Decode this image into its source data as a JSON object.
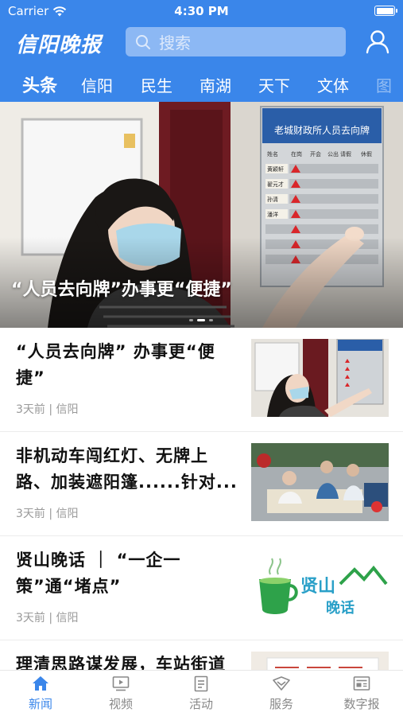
{
  "status_bar": {
    "carrier": "Carrier",
    "time": "4:30 PM"
  },
  "header": {
    "logo_text": "信阳晚报",
    "search_placeholder": "搜索",
    "brand_color": "#3a86ea"
  },
  "channel_tabs": [
    {
      "label": "头条",
      "active": true
    },
    {
      "label": "信阳"
    },
    {
      "label": "民生"
    },
    {
      "label": "南湖"
    },
    {
      "label": "天下"
    },
    {
      "label": "文体"
    },
    {
      "label": "图"
    }
  ],
  "banner": {
    "title": "“人员去向牌”办事更“便捷”",
    "board_heading": "老城财政所人员去向牌",
    "board_columns": [
      "姓名",
      "在岗",
      "开会",
      "公出",
      "请假",
      "休假"
    ],
    "board_names": [
      "黄颖轩",
      "翟元才",
      "孙清",
      "潘洋"
    ],
    "slide_count": 3,
    "active_slide": 2
  },
  "news": [
    {
      "title": "“人员去向牌” 办事更“便捷”",
      "meta": "3天前 | 信阳",
      "thumb": "board-photo"
    },
    {
      "title": "非机动车闯红灯、无牌上路、加装遮阳篷......针对...",
      "meta": "3天前 | 信阳",
      "thumb": "police-photo"
    },
    {
      "title": "贤山晚话 ｜ “一企一策”通“堵点”",
      "meta": "3天前 | 信阳",
      "thumb": "xianshan-logo",
      "thumb_text": [
        "贤山",
        "晚话"
      ]
    },
    {
      "title": "理清思路谋发展，车站街道",
      "meta": "",
      "thumb": "document-photo"
    }
  ],
  "tabbar": [
    {
      "label": "新闻",
      "icon": "home-icon",
      "active": true
    },
    {
      "label": "视频",
      "icon": "video-icon"
    },
    {
      "label": "活动",
      "icon": "activity-icon"
    },
    {
      "label": "服务",
      "icon": "service-icon"
    },
    {
      "label": "数字报",
      "icon": "newspaper-icon"
    }
  ]
}
